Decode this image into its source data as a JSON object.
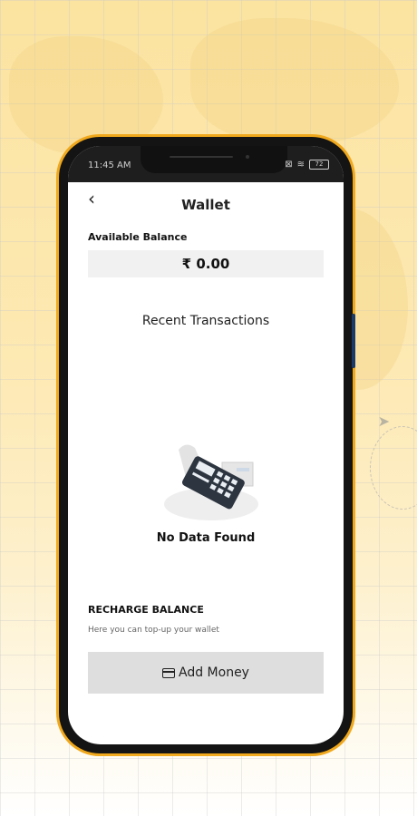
{
  "status_bar": {
    "time": "11:45 AM",
    "battery": "72"
  },
  "header": {
    "title": "Wallet",
    "back_icon": "chevron-left-icon"
  },
  "balance": {
    "label": "Available Balance",
    "amount": "₹ 0.00"
  },
  "transactions": {
    "title": "Recent Transactions",
    "empty_text": "No Data Found",
    "empty_icon": "card-machine-icon"
  },
  "recharge": {
    "title": "RECHARGE BALANCE",
    "subtitle": "Here you can top-up your wallet",
    "button_label": "Add Money",
    "button_icon": "credit-card-icon"
  },
  "colors": {
    "phone_frame": "#f0a81c",
    "background": "#fbe3a0",
    "button_bg": "#dedede"
  }
}
